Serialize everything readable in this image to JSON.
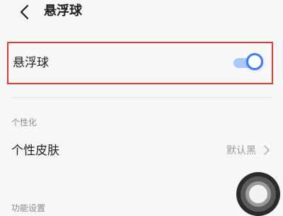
{
  "header": {
    "back_icon": "chevron-left-icon",
    "title": "悬浮球"
  },
  "floating_ball_setting": {
    "label": "悬浮球",
    "toggle_on": true,
    "toggle_color": "#3a7bff"
  },
  "personalization": {
    "section_title": "个性化",
    "skin_row": {
      "label": "个性皮肤",
      "value": "默认黑",
      "icon": "chevron-right-icon"
    }
  },
  "function_settings": {
    "section_title": "功能设置"
  },
  "assistive_ball": {
    "icon": "floating-ball-icon"
  }
}
